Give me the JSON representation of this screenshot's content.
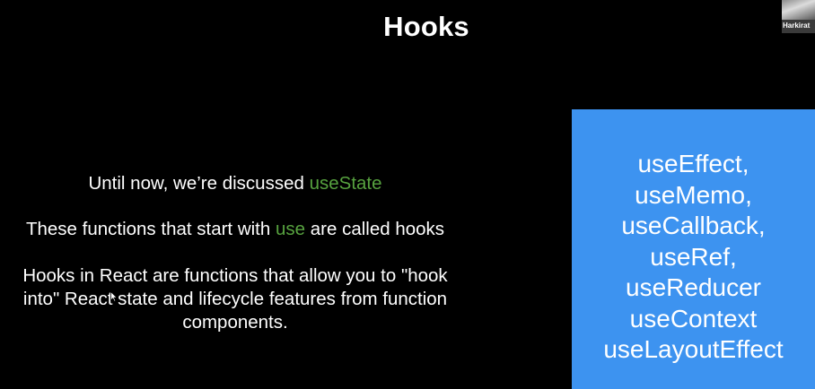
{
  "slide": {
    "title": "Hooks",
    "line1": {
      "before": "Until now, we’re discussed ",
      "highlight": "useState"
    },
    "line2": {
      "before": "These functions that start with ",
      "highlight": "use",
      "after": " are called hooks"
    },
    "line3": {
      "row1": "Hooks in React are functions that allow you to \"hook",
      "row2": "into\" React state and lifecycle features from function",
      "row3": "components."
    },
    "hooks": [
      "useEffect,",
      "useMemo,",
      "useCallback,",
      "useRef,",
      "useReducer",
      "useContext",
      "useLayoutEffect"
    ]
  },
  "presenter": {
    "name": "Harkirat"
  },
  "colors": {
    "background": "#000000",
    "highlight": "#57a23f",
    "hooks_box": "#3d93f0",
    "text": "#ffffff"
  },
  "icons": {
    "cursor": "mouse-pointer-icon"
  }
}
